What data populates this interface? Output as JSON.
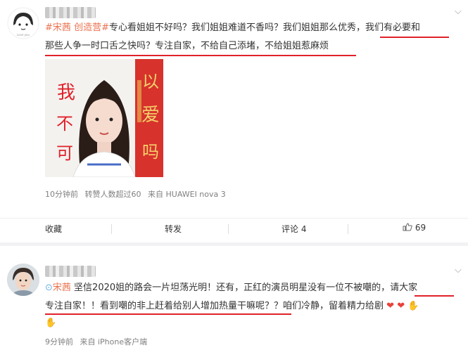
{
  "post1": {
    "text_hashtag_start": "#",
    "text_tag1": "宋茜",
    "text_tag2": "创造营",
    "text_hashtag_end": "#",
    "line1_rest": "专心看姐姐不好吗？我们姐姐难道不香吗？我们姐姐那么优秀",
    "line1_tail": "，我们有必要和",
    "line2": "那些人争一时口舌之快吗？专注自家，不给自己添堵，不给姐姐惹麻烦",
    "image_text_left": "我不可",
    "image_text_right": "以爱吗",
    "meta_time": "10分钟前",
    "meta_reposts": "转赞人数超过60",
    "meta_source": "来自 HUAWEI nova 3",
    "actions": {
      "collect": "收藏",
      "forward": "转发",
      "comment": "评论 4",
      "like": "69"
    }
  },
  "post2": {
    "tag": "宋茜",
    "line1_a": " 坚信2020姐的路会一片坦荡光明！还有，正红的演员明星没有一位不被嘲的，",
    "line1_b": "请大家",
    "line2_a": "专注自家！！看到嘲的非上赶着给别人增加热量干嘛呢？",
    "line2_b": "？咱们冷静，留着精力给剧",
    "meta_time": "9分钟前",
    "meta_source": "来自 iPhone客户端"
  },
  "colors": {
    "accent": "#eb7350",
    "underline": "#e0222a",
    "link_icon": "#6ab0e6"
  }
}
